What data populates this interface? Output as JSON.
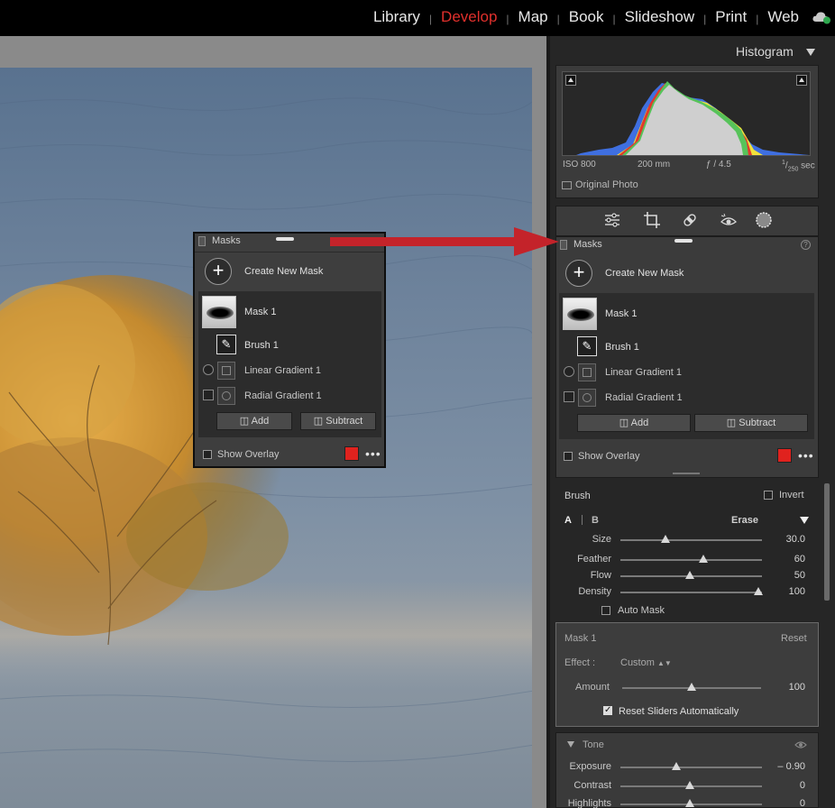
{
  "topbar": {
    "modules": [
      {
        "label": "Library",
        "active": false
      },
      {
        "label": "Develop",
        "active": true
      },
      {
        "label": "Map",
        "active": false
      },
      {
        "label": "Book",
        "active": false
      },
      {
        "label": "Slideshow",
        "active": false
      },
      {
        "label": "Print",
        "active": false
      },
      {
        "label": "Web",
        "active": false
      }
    ],
    "separator": "|",
    "cloud_icon": "cloud-sync-icon",
    "active_color": "#e0302c"
  },
  "histogram": {
    "title": "Histogram",
    "iso": "ISO 800",
    "focal": "200 mm",
    "aperture": "ƒ / 4.5",
    "shutter_num": "1",
    "shutter_den": "250",
    "shutter_unit": "sec",
    "original_photo": "Original Photo"
  },
  "tools": [
    "edit-sliders-icon",
    "crop-icon",
    "healing-icon",
    "red-eye-icon",
    "masking-icon"
  ],
  "masks_panel": {
    "title": "Masks",
    "create_new": "Create New Mask",
    "mask_name": "Mask 1",
    "components": [
      {
        "label": "Brush 1",
        "icon": "brush-icon"
      },
      {
        "label": "Linear Gradient 1",
        "icon": "linear-gradient-icon"
      },
      {
        "label": "Radial Gradient 1",
        "icon": "radial-gradient-icon"
      }
    ],
    "add": "Add",
    "subtract": "Subtract",
    "show_overlay": "Show Overlay",
    "overlay_color": "#e0221e",
    "more": "•••",
    "help": "?"
  },
  "brush": {
    "title": "Brush",
    "invert": "Invert",
    "tab_a": "A",
    "tab_b": "B",
    "erase": "Erase",
    "sliders": [
      {
        "label": "Size",
        "value": "30.0",
        "pos": 0.32
      },
      {
        "label": "Feather",
        "value": "60",
        "pos": 0.6
      },
      {
        "label": "Flow",
        "value": "50",
        "pos": 0.5
      },
      {
        "label": "Density",
        "value": "100",
        "pos": 1.0
      }
    ],
    "auto_mask": "Auto Mask"
  },
  "mask_settings": {
    "title": "Mask 1",
    "reset": "Reset",
    "effect_label": "Effect :",
    "effect_value": "Custom",
    "amount_label": "Amount",
    "amount_value": "100",
    "amount_pos": 0.5,
    "reset_sliders": "Reset Sliders Automatically"
  },
  "tone": {
    "title": "Tone",
    "sliders": [
      {
        "label": "Exposure",
        "value": "– 0.90",
        "pos": 0.4
      },
      {
        "label": "Contrast",
        "value": "0",
        "pos": 0.5
      },
      {
        "label": "Highlights",
        "value": "0",
        "pos": 0.5
      }
    ]
  }
}
